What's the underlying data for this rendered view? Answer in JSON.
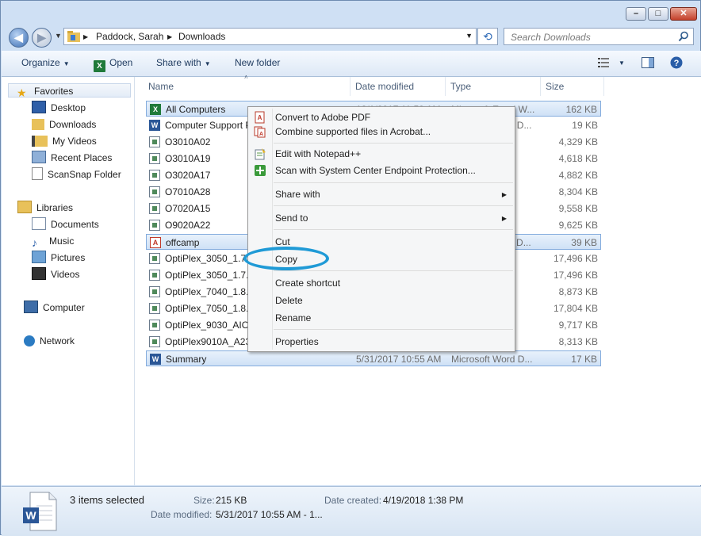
{
  "window": {
    "controls": [
      "minimize",
      "maximize",
      "close"
    ]
  },
  "address": {
    "breadcrumbs": [
      "Paddock, Sarah",
      "Downloads"
    ],
    "search_placeholder": "Search Downloads"
  },
  "toolbar": {
    "organize": "Organize",
    "open": "Open",
    "share_with": "Share with",
    "new_folder": "New folder"
  },
  "nav": {
    "favorites": "Favorites",
    "favorites_items": [
      "Desktop",
      "Downloads",
      "My Videos",
      "Recent Places",
      "ScanSnap Folder"
    ],
    "libraries": "Libraries",
    "libraries_items": [
      "Documents",
      "Music",
      "Pictures",
      "Videos"
    ],
    "computer": "Computer",
    "network": "Network"
  },
  "columns": {
    "name": "Name",
    "date": "Date modified",
    "type": "Type",
    "size": "Size"
  },
  "files": [
    {
      "name": "All Computers",
      "date": "12/1/2017 11:50 AM",
      "type": "Microsoft Excel W...",
      "size": "162 KB",
      "icon": "excel-icon",
      "selected": true
    },
    {
      "name": "Computer Support Pr",
      "date": "",
      "type": "Microsoft Word D...",
      "size": "19 KB",
      "icon": "word-icon",
      "selected": false
    },
    {
      "name": "O3010A02",
      "date": "",
      "type": "",
      "size": "4,329 KB",
      "icon": "exe-icon",
      "selected": false
    },
    {
      "name": "O3010A19",
      "date": "",
      "type": "",
      "size": "4,618 KB",
      "icon": "exe-icon",
      "selected": false
    },
    {
      "name": "O3020A17",
      "date": "",
      "type": "",
      "size": "4,882 KB",
      "icon": "exe-icon",
      "selected": false
    },
    {
      "name": "O7010A28",
      "date": "",
      "type": "",
      "size": "8,304 KB",
      "icon": "exe-icon",
      "selected": false
    },
    {
      "name": "O7020A15",
      "date": "",
      "type": "",
      "size": "9,558 KB",
      "icon": "exe-icon",
      "selected": false
    },
    {
      "name": "O9020A22",
      "date": "",
      "type": "",
      "size": "9,625 KB",
      "icon": "exe-icon",
      "selected": false
    },
    {
      "name": "offcamp",
      "date": "",
      "type": "Adobe Acrobat D...",
      "size": "39 KB",
      "icon": "pdf-icon",
      "selected": true
    },
    {
      "name": "OptiPlex_3050_1.7.5",
      "date": "",
      "type": "",
      "size": "17,496 KB",
      "icon": "exe-icon",
      "selected": false
    },
    {
      "name": "OptiPlex_3050_1.7.9",
      "date": "",
      "type": "",
      "size": "17,496 KB",
      "icon": "exe-icon",
      "selected": false
    },
    {
      "name": "OptiPlex_7040_1.8.1",
      "date": "",
      "type": "",
      "size": "8,873 KB",
      "icon": "exe-icon",
      "selected": false
    },
    {
      "name": "OptiPlex_7050_1.8.2",
      "date": "",
      "type": "",
      "size": "17,804 KB",
      "icon": "exe-icon",
      "selected": false
    },
    {
      "name": "OptiPlex_9030_AIO_",
      "date": "",
      "type": "",
      "size": "9,717 KB",
      "icon": "exe-icon",
      "selected": false
    },
    {
      "name": "OptiPlex9010A_A23",
      "date": "",
      "type": "",
      "size": "8,313 KB",
      "icon": "exe-icon",
      "selected": false
    },
    {
      "name": "Summary",
      "date": "5/31/2017 10:55 AM",
      "type": "Microsoft Word D...",
      "size": "17 KB",
      "icon": "word-icon",
      "selected": true
    }
  ],
  "context_menu": {
    "convert_pdf": "Convert to Adobe PDF",
    "combine_acrobat": "Combine supported files in Acrobat...",
    "edit_notepad": "Edit with Notepad++",
    "scan_scep": "Scan with System Center Endpoint Protection...",
    "share_with": "Share with",
    "send_to": "Send to",
    "cut": "Cut",
    "copy": "Copy",
    "create_shortcut": "Create shortcut",
    "delete": "Delete",
    "rename": "Rename",
    "properties": "Properties"
  },
  "status": {
    "selected_count": "3 items selected",
    "size_label": "Size:",
    "size_value": "215 KB",
    "date_created_label": "Date created:",
    "date_created_value": "4/19/2018 1:38 PM",
    "date_modified_label": "Date modified:",
    "date_modified_value": "5/31/2017 10:55 AM - 1..."
  },
  "colors": {
    "selection": "#cfe1f6",
    "highlight_ring": "#1f9ad6",
    "chrome": "#cfe0f4"
  }
}
